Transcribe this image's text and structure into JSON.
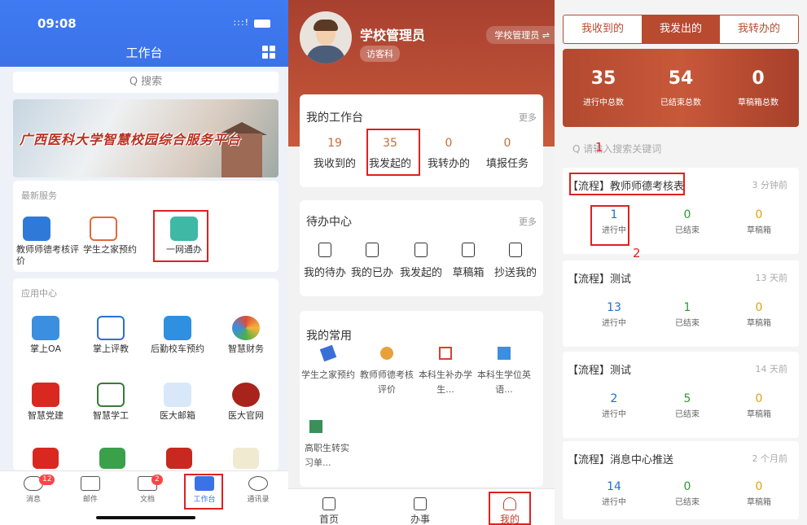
{
  "panel1": {
    "status": {
      "time": "09:08",
      "signal": ":::!"
    },
    "title": "工作台",
    "search_placeholder": "Q 搜索",
    "banner_text": "广西医科大学智慧校园综合服务平台",
    "latest_section": "最新服务",
    "latest": [
      {
        "label": "教师师德考核评价"
      },
      {
        "label": "学生之家预约"
      },
      {
        "label": "一网通办"
      }
    ],
    "apps_section": "应用中心",
    "apps": [
      {
        "label": "掌上OA"
      },
      {
        "label": "掌上评教"
      },
      {
        "label": "后勤校车预约"
      },
      {
        "label": "智慧财务"
      },
      {
        "label": "智慧党建"
      },
      {
        "label": "智慧学工"
      },
      {
        "label": "医大邮箱"
      },
      {
        "label": "医大官网"
      }
    ],
    "tabs": [
      {
        "label": "消息",
        "badge": "12"
      },
      {
        "label": "邮件",
        "badge": ""
      },
      {
        "label": "文档",
        "badge": "2"
      },
      {
        "label": "工作台",
        "badge": ""
      },
      {
        "label": "通讯录",
        "badge": ""
      }
    ]
  },
  "panel2": {
    "user": {
      "name": "学校管理员",
      "dept": "访客科",
      "role": "学校管理员 ⇌"
    },
    "workbench": {
      "title": "我的工作台",
      "more": "更多",
      "stats": [
        {
          "num": "19",
          "label": "我收到的"
        },
        {
          "num": "35",
          "label": "我发起的"
        },
        {
          "num": "0",
          "label": "我转办的"
        },
        {
          "num": "0",
          "label": "填报任务"
        }
      ]
    },
    "todo": {
      "title": "待办中心",
      "more": "更多",
      "items": [
        {
          "label": "我的待办"
        },
        {
          "label": "我的已办"
        },
        {
          "label": "我发起的"
        },
        {
          "label": "草稿箱"
        },
        {
          "label": "抄送我的"
        }
      ]
    },
    "common": {
      "title": "我的常用",
      "items": [
        {
          "label": "学生之家预约"
        },
        {
          "label": "教师师德考核评价"
        },
        {
          "label": "本科生补办学生..."
        },
        {
          "label": "本科生学位英语..."
        },
        {
          "label": "高职生转实习单..."
        }
      ]
    },
    "tabs": [
      {
        "label": "首页"
      },
      {
        "label": "办事"
      },
      {
        "label": "我的"
      }
    ]
  },
  "panel3": {
    "tabs": [
      {
        "label": "我收到的"
      },
      {
        "label": "我发出的"
      },
      {
        "label": "我转办的"
      }
    ],
    "summary": [
      {
        "num": "35",
        "label": "进行中总数"
      },
      {
        "num": "54",
        "label": "已结束总数"
      },
      {
        "num": "0",
        "label": "草稿箱总数"
      }
    ],
    "search_placeholder": "Q 请输入搜索关键词",
    "annot1": "1",
    "annot2": "2",
    "flows": [
      {
        "title": "【流程】教师师德考核表",
        "time": "3 分钟前",
        "running": "1",
        "done": "0",
        "draft": "0"
      },
      {
        "title": "【流程】测试",
        "time": "13 天前",
        "running": "13",
        "done": "1",
        "draft": "0"
      },
      {
        "title": "【流程】测试",
        "time": "14 天前",
        "running": "2",
        "done": "5",
        "draft": "0"
      },
      {
        "title": "【流程】消息中心推送",
        "time": "2 个月前",
        "running": "14",
        "done": "0",
        "draft": "0"
      }
    ],
    "labels": {
      "running": "进行中",
      "done": "已结束",
      "draft": "草稿箱"
    }
  },
  "colors": {
    "primary_blue": "#3b72e8",
    "brand_red": "#b84a30",
    "running": "#1f6fd0",
    "done": "#2e9a2e",
    "draft": "#e0a010",
    "highlight": "#e02020"
  }
}
